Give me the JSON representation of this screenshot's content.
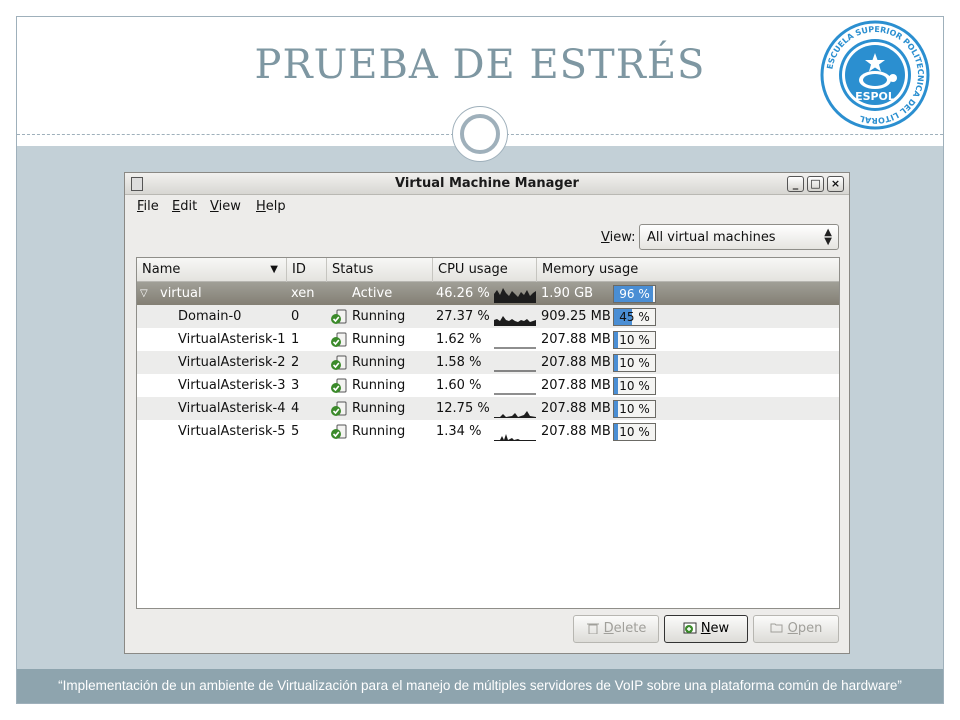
{
  "slide": {
    "title": "PRUEBA DE ESTRÉS",
    "footer": "“Implementación de un ambiente de Virtualización para el manejo de múltiples servidores de VoIP sobre una plataforma común de hardware”",
    "logo": {
      "ring_text": "ESCUELA SUPERIOR POLITECNICA DEL LITORAL",
      "name": "ESPOL",
      "icon": "turtle-star-seal"
    }
  },
  "window": {
    "title": "Virtual Machine Manager",
    "controls": {
      "minimize": "_",
      "maximize": "□",
      "close": "×"
    }
  },
  "menu": [
    {
      "key": "F",
      "rest": "ile"
    },
    {
      "key": "E",
      "rest": "dit"
    },
    {
      "key": "V",
      "rest": "iew"
    },
    {
      "key": "H",
      "rest": "elp"
    }
  ],
  "view_filter": {
    "label_key": "V",
    "label_rest": "iew:",
    "value": "All virtual machines"
  },
  "columns": {
    "name": "Name",
    "id": "ID",
    "status": "Status",
    "cpu": "CPU usage",
    "memory": "Memory usage"
  },
  "host": {
    "name": "virtual",
    "id": "xen",
    "status": "Active",
    "cpu": "46.26 %",
    "memory": "1.90 GB",
    "memory_pct": 96,
    "memory_pct_text": "96 %"
  },
  "vms": [
    {
      "name": "Domain-0",
      "id": "0",
      "status": "Running",
      "cpu": "27.37 %",
      "memory": "909.25 MB",
      "memory_pct": 45,
      "memory_pct_text": "45 %"
    },
    {
      "name": "VirtualAsterisk-1",
      "id": "1",
      "status": "Running",
      "cpu": "1.62 %",
      "memory": "207.88 MB",
      "memory_pct": 10,
      "memory_pct_text": "10 %"
    },
    {
      "name": "VirtualAsterisk-2",
      "id": "2",
      "status": "Running",
      "cpu": "1.58 %",
      "memory": "207.88 MB",
      "memory_pct": 10,
      "memory_pct_text": "10 %"
    },
    {
      "name": "VirtualAsterisk-3",
      "id": "3",
      "status": "Running",
      "cpu": "1.60 %",
      "memory": "207.88 MB",
      "memory_pct": 10,
      "memory_pct_text": "10 %"
    },
    {
      "name": "VirtualAsterisk-4",
      "id": "4",
      "status": "Running",
      "cpu": "12.75 %",
      "memory": "207.88 MB",
      "memory_pct": 10,
      "memory_pct_text": "10 %"
    },
    {
      "name": "VirtualAsterisk-5",
      "id": "5",
      "status": "Running",
      "cpu": "1.34 %",
      "memory": "207.88 MB",
      "memory_pct": 10,
      "memory_pct_text": "10 %"
    }
  ],
  "buttons": {
    "delete": {
      "key": "D",
      "rest": "elete"
    },
    "new": {
      "key": "N",
      "rest": "ew"
    },
    "open": {
      "key": "O",
      "rest": "pen"
    }
  },
  "colors": {
    "title": "#7e97a2",
    "footer_bg": "#8ea4ae",
    "content_band": "#c3d0d7",
    "mem_fill": "#4a8ed4",
    "selected_row": "#837f74"
  }
}
